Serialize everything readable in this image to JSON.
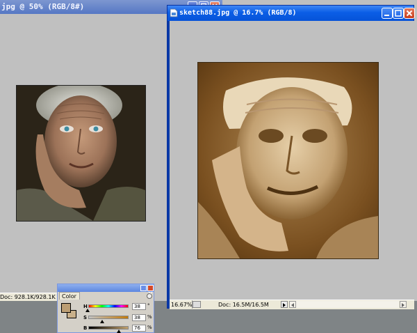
{
  "back_window": {
    "title": "jpg @ 50% (RGB/8#)",
    "status": "Doc: 928.1K/928.1K"
  },
  "front_window": {
    "title": "sketch88.jpg @ 16.7% (RGB/8)",
    "zoom": "16.67%",
    "doc_size": "Doc: 16.5M/16.5M"
  },
  "color_palette": {
    "tab_label": "Color",
    "foreground_color": "#bc9e74",
    "background_color": "#c9b08a",
    "sliders": [
      {
        "label": "H",
        "value": "38",
        "unit": "°"
      },
      {
        "label": "S",
        "value": "38",
        "unit": "%"
      },
      {
        "label": "B",
        "value": "76",
        "unit": "%"
      }
    ]
  }
}
